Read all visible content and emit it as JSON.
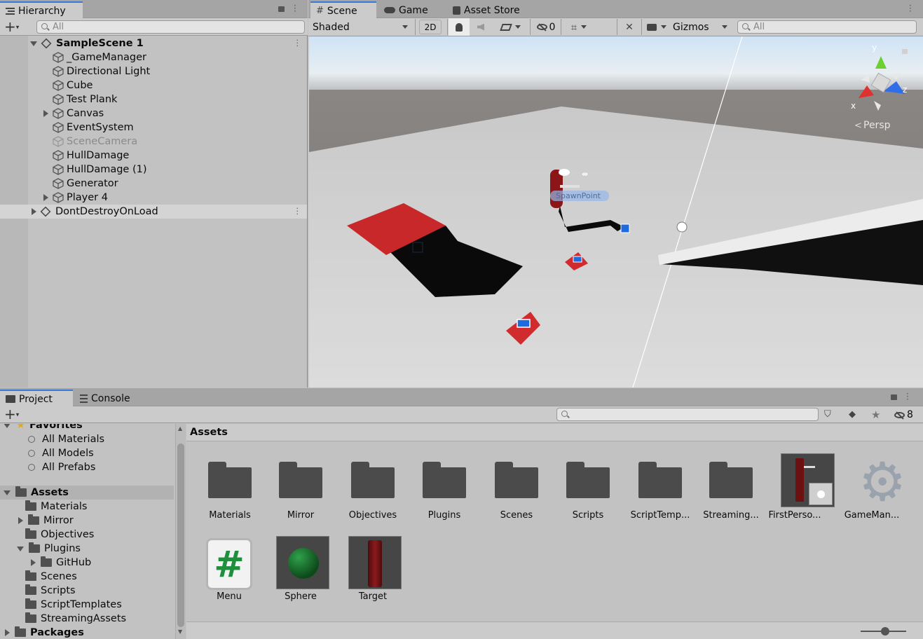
{
  "hierarchy": {
    "tab_label": "Hierarchy",
    "search_placeholder": "All",
    "scene_name": "SampleScene 1",
    "items": [
      {
        "label": "_GameManager",
        "expandable": false,
        "dimmed": false
      },
      {
        "label": "Directional Light",
        "expandable": false,
        "dimmed": false
      },
      {
        "label": "Cube",
        "expandable": false,
        "dimmed": false
      },
      {
        "label": "Test Plank",
        "expandable": false,
        "dimmed": false
      },
      {
        "label": "Canvas",
        "expandable": true,
        "dimmed": false
      },
      {
        "label": "EventSystem",
        "expandable": false,
        "dimmed": false
      },
      {
        "label": "SceneCamera",
        "expandable": false,
        "dimmed": true
      },
      {
        "label": "HullDamage",
        "expandable": false,
        "dimmed": false
      },
      {
        "label": "HullDamage (1)",
        "expandable": false,
        "dimmed": false
      },
      {
        "label": "Generator",
        "expandable": false,
        "dimmed": false
      },
      {
        "label": "Player 4",
        "expandable": true,
        "dimmed": false
      }
    ],
    "ddol_label": "DontDestroyOnLoad"
  },
  "scene_view": {
    "tabs": [
      {
        "label": "Scene",
        "icon": "grid-icon",
        "active": true
      },
      {
        "label": "Game",
        "icon": "gamepad-icon",
        "active": false
      },
      {
        "label": "Asset Store",
        "icon": "bag-icon",
        "active": false
      }
    ],
    "shading_mode": "Shaded",
    "mode_2d_label": "2D",
    "hidden_count": "0",
    "gizmos_label": "Gizmos",
    "search_placeholder": "All",
    "gizmo_axes": {
      "y": "y",
      "z": "z",
      "x": "x"
    },
    "projection_label": "Persp",
    "object_label": "SpawnPoint"
  },
  "project": {
    "tabs": [
      {
        "label": "Project",
        "active": true
      },
      {
        "label": "Console",
        "active": false
      }
    ],
    "hidden_count": "8",
    "favorites_label": "Favorites",
    "favorites": [
      "All Materials",
      "All Models",
      "All Prefabs"
    ],
    "tree": [
      {
        "label": "Assets",
        "level": 0,
        "arrow": "down",
        "bold": true
      },
      {
        "label": "Materials",
        "level": 1,
        "arrow": "none",
        "bold": false
      },
      {
        "label": "Mirror",
        "level": 1,
        "arrow": "right",
        "bold": false
      },
      {
        "label": "Objectives",
        "level": 1,
        "arrow": "none",
        "bold": false
      },
      {
        "label": "Plugins",
        "level": 1,
        "arrow": "down",
        "bold": false
      },
      {
        "label": "GitHub",
        "level": 2,
        "arrow": "right",
        "bold": false
      },
      {
        "label": "Scenes",
        "level": 1,
        "arrow": "none",
        "bold": false
      },
      {
        "label": "Scripts",
        "level": 1,
        "arrow": "none",
        "bold": false
      },
      {
        "label": "ScriptTemplates",
        "level": 1,
        "arrow": "none",
        "bold": false
      },
      {
        "label": "StreamingAssets",
        "level": 1,
        "arrow": "none",
        "bold": false
      },
      {
        "label": "Packages",
        "level": 0,
        "arrow": "right",
        "bold": true
      }
    ],
    "breadcrumb": "Assets",
    "assets_row1": [
      {
        "label": "Materials",
        "kind": "folder"
      },
      {
        "label": "Mirror",
        "kind": "folder"
      },
      {
        "label": "Objectives",
        "kind": "folder"
      },
      {
        "label": "Plugins",
        "kind": "folder"
      },
      {
        "label": "Scenes",
        "kind": "folder"
      },
      {
        "label": "Scripts",
        "kind": "folder"
      },
      {
        "label": "ScriptTemp...",
        "kind": "folder"
      },
      {
        "label": "Streaming...",
        "kind": "folder"
      },
      {
        "label": "FirstPerso...",
        "kind": "prefab"
      },
      {
        "label": "GameMan...",
        "kind": "gear"
      }
    ],
    "assets_row2": [
      {
        "label": "Menu",
        "kind": "script"
      },
      {
        "label": "Sphere",
        "kind": "material"
      },
      {
        "label": "Target",
        "kind": "cylinder"
      }
    ]
  },
  "colors": {
    "accent": "#3a79d8",
    "red_object": "#c8282a",
    "sky_top": "#cfe3f6"
  }
}
